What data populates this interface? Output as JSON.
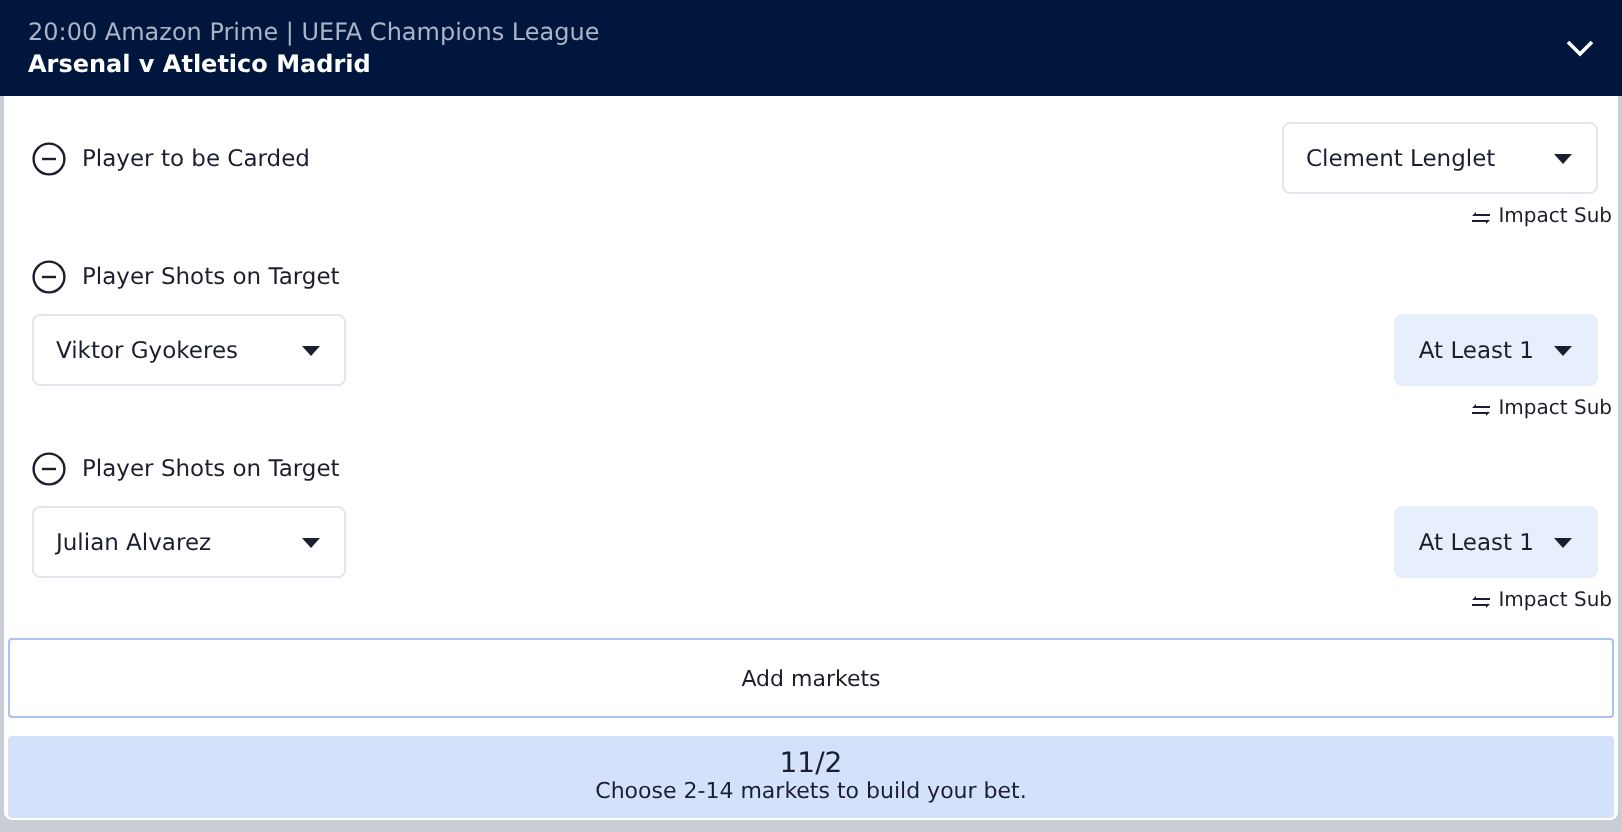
{
  "header": {
    "subtitle": "20:00 Amazon Prime | UEFA Champions League",
    "title": "Arsenal v Atletico Madrid",
    "expanded": true
  },
  "markets": [
    {
      "kind": "inline",
      "title": "Player to be Carded",
      "selectors": [
        {
          "kind": "player",
          "value": "Clement Lenglet"
        }
      ],
      "impact_sub": "Impact Sub"
    },
    {
      "kind": "stacked",
      "title": "Player Shots on Target",
      "selectors": [
        {
          "kind": "player",
          "value": "Viktor Gyokeres"
        },
        {
          "kind": "threshold",
          "value": "At Least 1"
        }
      ],
      "impact_sub": "Impact Sub"
    },
    {
      "kind": "stacked",
      "title": "Player Shots on Target",
      "selectors": [
        {
          "kind": "player",
          "value": "Julian Alvarez"
        },
        {
          "kind": "threshold",
          "value": "At Least 1"
        }
      ],
      "impact_sub": "Impact Sub"
    }
  ],
  "add_markets": "Add markets",
  "bet": {
    "odds": "11/2",
    "hint": "Choose 2-14 markets to build your bet."
  }
}
